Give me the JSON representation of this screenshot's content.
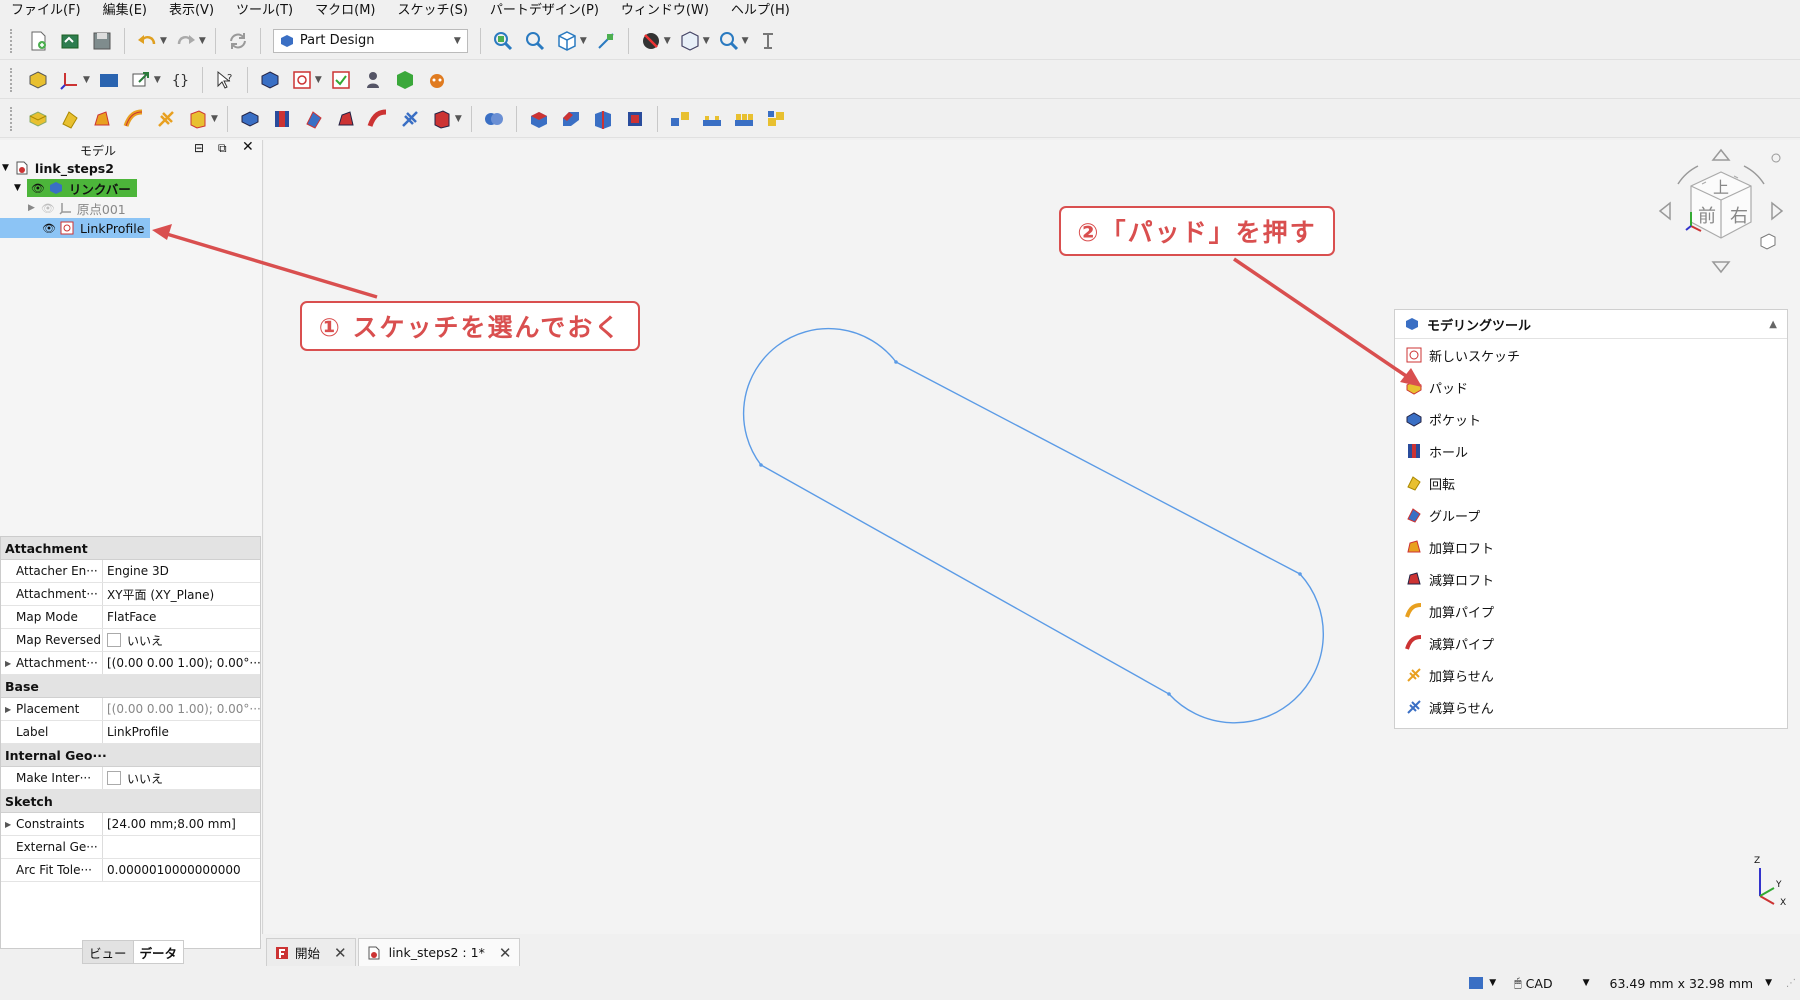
{
  "menu": [
    "ファイル(F)",
    "編集(E)",
    "表示(V)",
    "ツール(T)",
    "マクロ(M)",
    "スケッチ(S)",
    "パートデザイン(P)",
    "ウィンドウ(W)",
    "ヘルプ(H)"
  ],
  "toolbar": {
    "workbench": "Part Design"
  },
  "left_panel": {
    "title": "モデル",
    "tree": {
      "document": "link_steps2",
      "body": "リンクバー",
      "origin": "原点001",
      "sketch": "LinkProfile"
    },
    "properties": {
      "groups": [
        {
          "name": "Attachment",
          "rows": [
            {
              "key": "Attacher En···",
              "value": "Engine 3D"
            },
            {
              "key": "Attachment···",
              "value": "XY平面 (XY_Plane)"
            },
            {
              "key": "Map Mode",
              "value": "FlatFace"
            },
            {
              "key": "Map Reversed",
              "value": "いいえ",
              "checkbox": true
            },
            {
              "key": "Attachment···",
              "value": "[(0.00 0.00 1.00); 0.00°···",
              "expandable": true
            }
          ]
        },
        {
          "name": "Base",
          "rows": [
            {
              "key": "Placement",
              "value": "[(0.00 0.00 1.00); 0.00°···",
              "expandable": true,
              "greyed": true
            },
            {
              "key": "Label",
              "value": "LinkProfile"
            }
          ]
        },
        {
          "name": "Internal Geo···",
          "rows": [
            {
              "key": "Make Inter···",
              "value": "いいえ",
              "checkbox": true
            }
          ]
        },
        {
          "name": "Sketch",
          "rows": [
            {
              "key": "Constraints",
              "value": "[24.00 mm;8.00 mm]",
              "expandable": true
            },
            {
              "key": "External Ge···",
              "value": ""
            },
            {
              "key": "Arc Fit Tole···",
              "value": "0.0000010000000000"
            }
          ]
        }
      ]
    },
    "tabs": [
      "ビュー",
      "データ"
    ]
  },
  "modeling_tools": {
    "title": "モデリングツール",
    "items": [
      "新しいスケッチ",
      "パッド",
      "ポケット",
      "ホール",
      "回転",
      "グループ",
      "加算ロフト",
      "減算ロフト",
      "加算パイプ",
      "減算パイプ",
      "加算らせん",
      "減算らせん"
    ]
  },
  "callouts": {
    "step1": "① スケッチを選んでおく",
    "step2": "②「パッド」を押す"
  },
  "navcube": {
    "top": "上",
    "front": "前",
    "right": "右"
  },
  "axes": {
    "z": "Z",
    "y": "Y",
    "x": "X"
  },
  "doc_tabs": [
    {
      "label": "開始"
    },
    {
      "label": "link_steps2 : 1*"
    }
  ],
  "status": {
    "nav_style": "CAD",
    "dimensions": "63.49 mm x 32.98 mm"
  },
  "colors": {
    "callout": "#d94f4f",
    "sketch_line": "#5b9be6",
    "selection": "#8cc4f5",
    "body_highlight": "#4cb53a"
  }
}
